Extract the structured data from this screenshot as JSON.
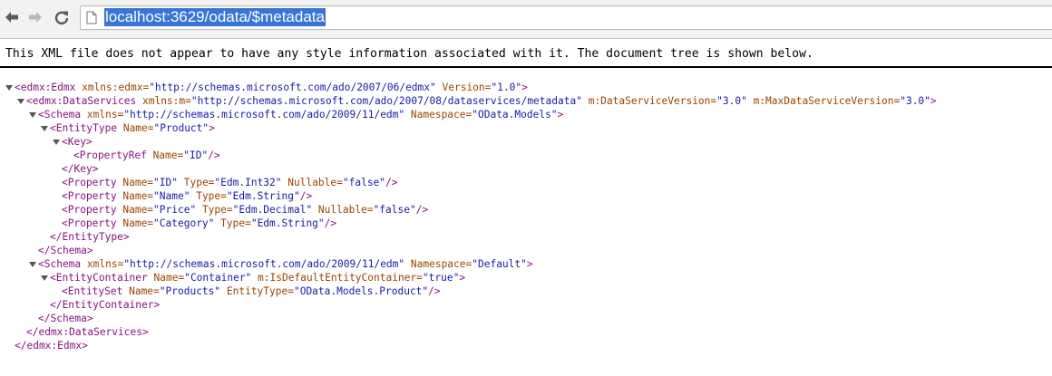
{
  "browser": {
    "url": "localhost:3629/odata/$metadata",
    "icons": {
      "back": "back-arrow-icon",
      "forward": "forward-arrow-icon",
      "reload": "reload-icon",
      "page": "page-icon"
    }
  },
  "banner": {
    "text": "This XML file does not appear to have any style information associated with it. The document tree is shown below."
  },
  "colors": {
    "tag": "#881280",
    "attr_name": "#994500",
    "attr_value": "#1a1aa6",
    "selection": "#3875d7"
  },
  "xml_tree": [
    {
      "indent": 0,
      "toggle": true,
      "tokens": [
        {
          "t": "tag",
          "v": "<edmx:Edmx"
        },
        {
          "t": "an",
          "v": " xmlns:edmx="
        },
        {
          "t": "av",
          "v": "\"http://schemas.microsoft.com/ado/2007/06/edmx\""
        },
        {
          "t": "an",
          "v": " Version="
        },
        {
          "t": "av",
          "v": "\"1.0\""
        },
        {
          "t": "tag",
          "v": ">"
        }
      ]
    },
    {
      "indent": 1,
      "toggle": true,
      "tokens": [
        {
          "t": "tag",
          "v": "<edmx:DataServices"
        },
        {
          "t": "an",
          "v": " xmlns:m="
        },
        {
          "t": "av",
          "v": "\"http://schemas.microsoft.com/ado/2007/08/dataservices/metadata\""
        },
        {
          "t": "an",
          "v": " m:DataServiceVersion="
        },
        {
          "t": "av",
          "v": "\"3.0\""
        },
        {
          "t": "an",
          "v": " m:MaxDataServiceVersion="
        },
        {
          "t": "av",
          "v": "\"3.0\""
        },
        {
          "t": "tag",
          "v": ">"
        }
      ]
    },
    {
      "indent": 2,
      "toggle": true,
      "tokens": [
        {
          "t": "tag",
          "v": "<Schema"
        },
        {
          "t": "an",
          "v": " xmlns="
        },
        {
          "t": "av",
          "v": "\"http://schemas.microsoft.com/ado/2009/11/edm\""
        },
        {
          "t": "an",
          "v": " Namespace="
        },
        {
          "t": "av",
          "v": "\"OData.Models\""
        },
        {
          "t": "tag",
          "v": ">"
        }
      ]
    },
    {
      "indent": 3,
      "toggle": true,
      "tokens": [
        {
          "t": "tag",
          "v": "<EntityType"
        },
        {
          "t": "an",
          "v": " Name="
        },
        {
          "t": "av",
          "v": "\"Product\""
        },
        {
          "t": "tag",
          "v": ">"
        }
      ]
    },
    {
      "indent": 4,
      "toggle": true,
      "tokens": [
        {
          "t": "tag",
          "v": "<Key>"
        }
      ]
    },
    {
      "indent": 5,
      "toggle": false,
      "tokens": [
        {
          "t": "tag",
          "v": "<PropertyRef"
        },
        {
          "t": "an",
          "v": " Name="
        },
        {
          "t": "av",
          "v": "\"ID\""
        },
        {
          "t": "tag",
          "v": "/>"
        }
      ]
    },
    {
      "indent": 4,
      "toggle": false,
      "tokens": [
        {
          "t": "tag",
          "v": "</Key>"
        }
      ]
    },
    {
      "indent": 4,
      "toggle": false,
      "tokens": [
        {
          "t": "tag",
          "v": "<Property"
        },
        {
          "t": "an",
          "v": " Name="
        },
        {
          "t": "av",
          "v": "\"ID\""
        },
        {
          "t": "an",
          "v": " Type="
        },
        {
          "t": "av",
          "v": "\"Edm.Int32\""
        },
        {
          "t": "an",
          "v": " Nullable="
        },
        {
          "t": "av",
          "v": "\"false\""
        },
        {
          "t": "tag",
          "v": "/>"
        }
      ]
    },
    {
      "indent": 4,
      "toggle": false,
      "tokens": [
        {
          "t": "tag",
          "v": "<Property"
        },
        {
          "t": "an",
          "v": " Name="
        },
        {
          "t": "av",
          "v": "\"Name\""
        },
        {
          "t": "an",
          "v": " Type="
        },
        {
          "t": "av",
          "v": "\"Edm.String\""
        },
        {
          "t": "tag",
          "v": "/>"
        }
      ]
    },
    {
      "indent": 4,
      "toggle": false,
      "tokens": [
        {
          "t": "tag",
          "v": "<Property"
        },
        {
          "t": "an",
          "v": " Name="
        },
        {
          "t": "av",
          "v": "\"Price\""
        },
        {
          "t": "an",
          "v": " Type="
        },
        {
          "t": "av",
          "v": "\"Edm.Decimal\""
        },
        {
          "t": "an",
          "v": " Nullable="
        },
        {
          "t": "av",
          "v": "\"false\""
        },
        {
          "t": "tag",
          "v": "/>"
        }
      ]
    },
    {
      "indent": 4,
      "toggle": false,
      "tokens": [
        {
          "t": "tag",
          "v": "<Property"
        },
        {
          "t": "an",
          "v": " Name="
        },
        {
          "t": "av",
          "v": "\"Category\""
        },
        {
          "t": "an",
          "v": " Type="
        },
        {
          "t": "av",
          "v": "\"Edm.String\""
        },
        {
          "t": "tag",
          "v": "/>"
        }
      ]
    },
    {
      "indent": 3,
      "toggle": false,
      "tokens": [
        {
          "t": "tag",
          "v": "</EntityType>"
        }
      ]
    },
    {
      "indent": 2,
      "toggle": false,
      "tokens": [
        {
          "t": "tag",
          "v": "</Schema>"
        }
      ]
    },
    {
      "indent": 2,
      "toggle": true,
      "tokens": [
        {
          "t": "tag",
          "v": "<Schema"
        },
        {
          "t": "an",
          "v": " xmlns="
        },
        {
          "t": "av",
          "v": "\"http://schemas.microsoft.com/ado/2009/11/edm\""
        },
        {
          "t": "an",
          "v": " Namespace="
        },
        {
          "t": "av",
          "v": "\"Default\""
        },
        {
          "t": "tag",
          "v": ">"
        }
      ]
    },
    {
      "indent": 3,
      "toggle": true,
      "tokens": [
        {
          "t": "tag",
          "v": "<EntityContainer"
        },
        {
          "t": "an",
          "v": " Name="
        },
        {
          "t": "av",
          "v": "\"Container\""
        },
        {
          "t": "an",
          "v": " m:IsDefaultEntityContainer="
        },
        {
          "t": "av",
          "v": "\"true\""
        },
        {
          "t": "tag",
          "v": ">"
        }
      ]
    },
    {
      "indent": 4,
      "toggle": false,
      "tokens": [
        {
          "t": "tag",
          "v": "<EntitySet"
        },
        {
          "t": "an",
          "v": " Name="
        },
        {
          "t": "av",
          "v": "\"Products\""
        },
        {
          "t": "an",
          "v": " EntityType="
        },
        {
          "t": "av",
          "v": "\"OData.Models.Product\""
        },
        {
          "t": "tag",
          "v": "/>"
        }
      ]
    },
    {
      "indent": 3,
      "toggle": false,
      "tokens": [
        {
          "t": "tag",
          "v": "</EntityContainer>"
        }
      ]
    },
    {
      "indent": 2,
      "toggle": false,
      "tokens": [
        {
          "t": "tag",
          "v": "</Schema>"
        }
      ]
    },
    {
      "indent": 1,
      "toggle": false,
      "tokens": [
        {
          "t": "tag",
          "v": "</edmx:DataServices>"
        }
      ]
    },
    {
      "indent": 0,
      "toggle": false,
      "tokens": [
        {
          "t": "tag",
          "v": "</edmx:Edmx>"
        }
      ]
    }
  ]
}
